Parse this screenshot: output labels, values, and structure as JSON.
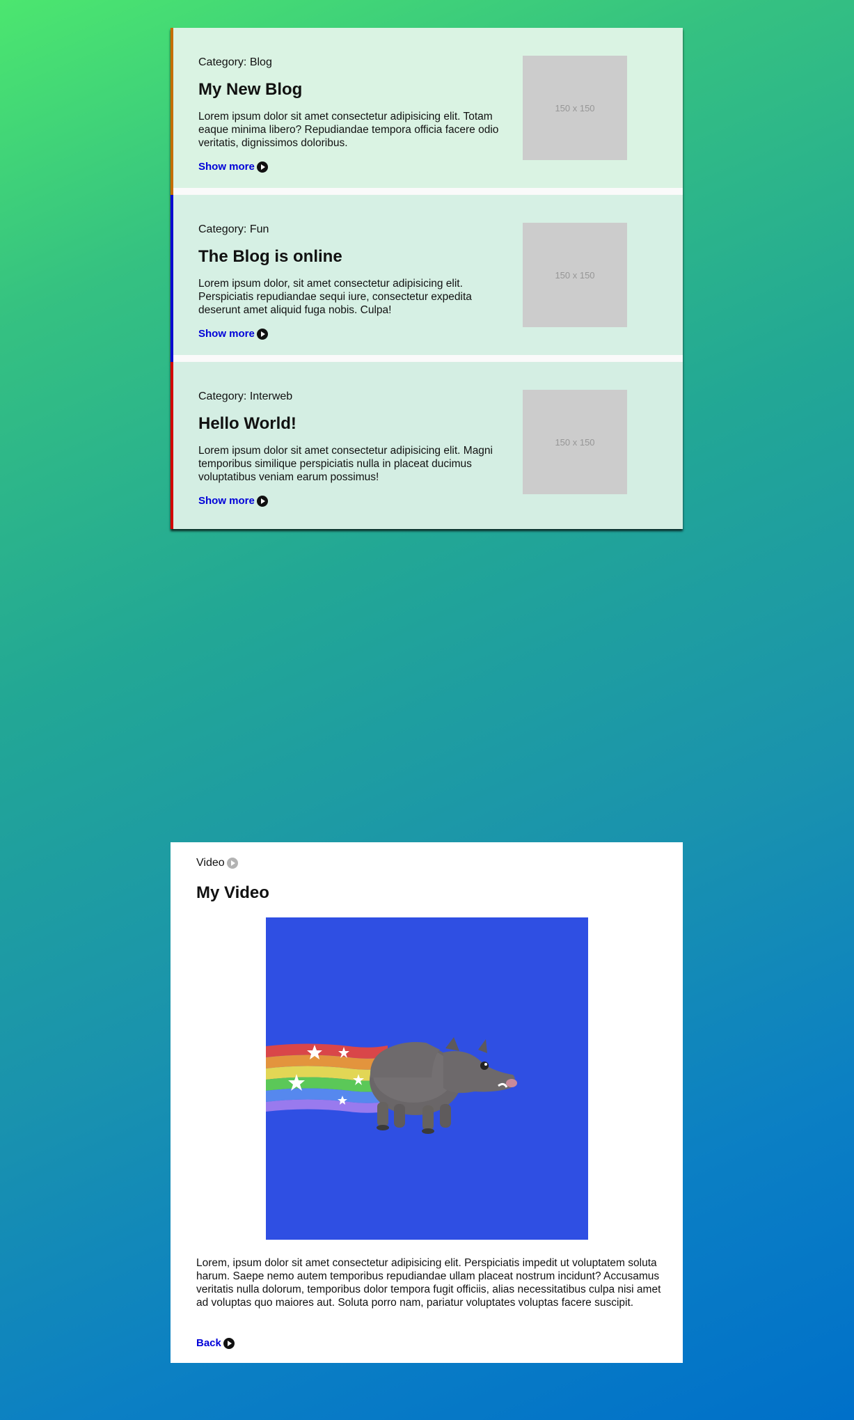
{
  "posts": [
    {
      "category": "Category: Blog",
      "title": "My New Blog",
      "excerpt": "Lorem ipsum dolor sit amet consectetur adipisicing elit. Totam eaque minima libero? Repudiandae tempora officia facere odio veritatis, dignissimos doloribus.",
      "more_label": "Show more",
      "thumb_label": "150 x 150",
      "accent": "#c46e00"
    },
    {
      "category": "Category: Fun",
      "title": "The Blog is online",
      "excerpt": "Lorem ipsum dolor, sit amet consectetur adipisicing elit. Perspiciatis repudiandae sequi iure, consectetur expedita deserunt amet aliquid fuga nobis. Culpa!",
      "more_label": "Show more",
      "thumb_label": "150 x 150",
      "accent": "#0b0bd0"
    },
    {
      "category": "Category: Interweb",
      "title": "Hello World!",
      "excerpt": "Lorem ipsum dolor sit amet consectetur adipisicing elit. Magni temporibus similique perspiciatis nulla in placeat ducimus voluptatibus veniam earum possimus!",
      "more_label": "Show more",
      "thumb_label": "150 x 150",
      "accent": "#d20000"
    }
  ],
  "video": {
    "category": "Video",
    "title": "My Video",
    "text": "Lorem, ipsum dolor sit amet consectetur adipisicing elit. Perspiciatis impedit ut voluptatem soluta harum. Saepe nemo autem temporibus repudiandae ullam placeat nostrum incidunt? Accusamus veritatis nulla dolorum, temporibus dolor tempora fugit officiis, alias necessitatibus culpa nisi amet ad voluptas quo maiores aut. Soluta porro nam, pariatur voluptates voluptas facere suscipit.",
    "back_label": "Back",
    "player_background": "#2f4fe3"
  },
  "icons": {
    "more": "play-circle-icon",
    "video_category": "play-circle-icon"
  }
}
